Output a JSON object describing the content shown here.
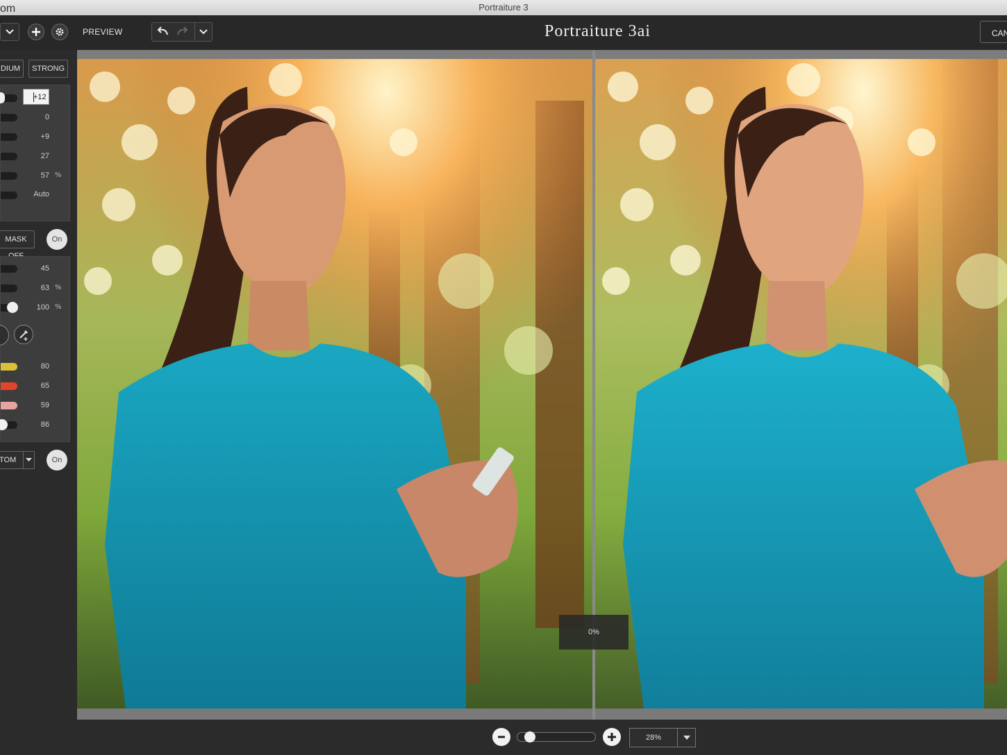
{
  "window": {
    "title": "Portraiture 3",
    "corner_fragment": "om"
  },
  "toolbar": {
    "preview_label": "PREVIEW",
    "app_title": "Portraiture 3ai",
    "cancel_label": "CAN"
  },
  "presets": {
    "medium_label": "DIUM",
    "strong_label": "STRONG"
  },
  "smoothing": {
    "values": [
      "+12",
      "0",
      "+9",
      "27",
      "57",
      "Auto"
    ],
    "percent_sign": "%"
  },
  "mask": {
    "button_label": "MASK OFF",
    "toggle_label": "On",
    "values": [
      "45",
      "63",
      "100"
    ],
    "percent_sign": "%"
  },
  "enhance": {
    "values": [
      "80",
      "65",
      "59",
      "86"
    ],
    "dropdown_label": "TOM",
    "toggle_label": "On"
  },
  "colors": {
    "swatch_yellow": "#d9c13a",
    "swatch_red": "#e0462a",
    "swatch_pink": "#e5a4a0"
  },
  "canvas": {
    "progress_label": "0%"
  },
  "zoom": {
    "value": "28%",
    "level_fraction": 0.1
  }
}
